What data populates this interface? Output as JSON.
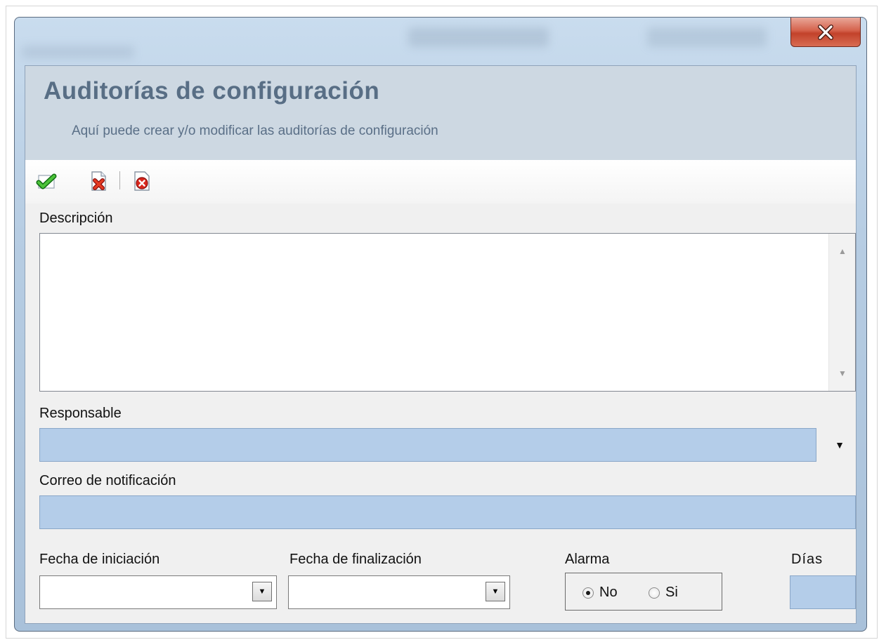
{
  "window": {
    "close_glyph": "X"
  },
  "header": {
    "title": "Auditorías de configuración",
    "subtitle": "Aquí puede crear y/o modificar las auditorías de configuración"
  },
  "toolbar": {
    "items": [
      {
        "name": "save",
        "icon": "save-check-icon"
      },
      {
        "name": "cancel",
        "icon": "cancel-document-icon"
      },
      {
        "name": "close",
        "icon": "close-circle-icon"
      }
    ]
  },
  "form": {
    "descripcion": {
      "label": "Descripción",
      "value": ""
    },
    "responsable": {
      "label": "Responsable",
      "value": ""
    },
    "correo": {
      "label": "Correo de notificación",
      "value": ""
    },
    "fecha_inicio": {
      "label": "Fecha de iniciación",
      "value": ""
    },
    "fecha_fin": {
      "label": "Fecha de finalización",
      "value": ""
    },
    "alarma": {
      "label": "Alarma",
      "options": [
        "No",
        "Si"
      ],
      "selected": "No"
    },
    "dias": {
      "label": "Días",
      "value": ""
    }
  },
  "colors": {
    "field_fill": "#b4cde9",
    "header_bg": "#cdd8e2",
    "title_color": "#586e85"
  }
}
